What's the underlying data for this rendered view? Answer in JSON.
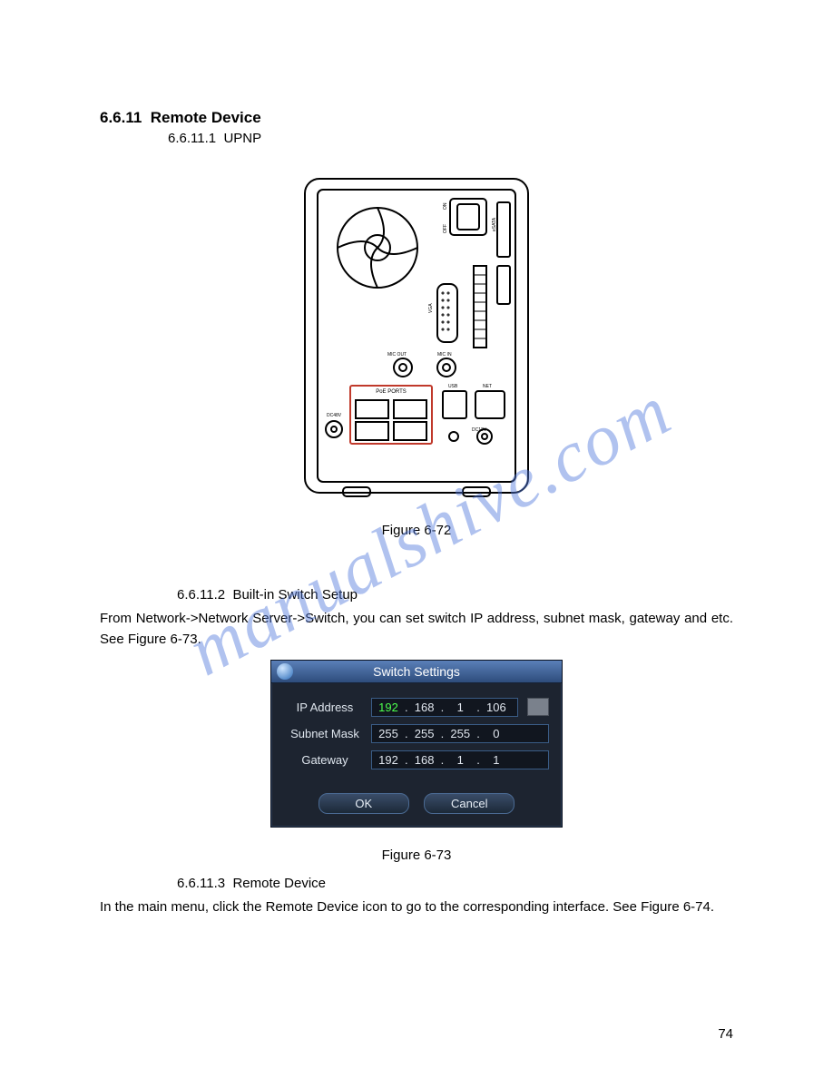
{
  "watermark": "manualshive.com",
  "section": {
    "number": "6.6.11",
    "title": "Remote Device",
    "sub1_number": "6.6.11.1",
    "sub1_title": "UPNP",
    "fig1_caption": "Figure 6-72",
    "sub2_number": "6.6.11.2",
    "sub2_title": "Built-in Switch Setup",
    "para1": "From Network->Network Server->Switch, you can set switch IP address, subnet mask, gateway and etc. See Figure 6-73.",
    "fig2_caption": "Figure 6-73",
    "sub3_number": "6.6.11.3",
    "sub3_title": "Remote Device",
    "para2": "In the main menu, click the Remote Device icon to go to the corresponding interface. See Figure 6-74."
  },
  "device_labels": {
    "poe": "PoE PORTS",
    "vga": "VGA",
    "mic_out": "MIC OUT",
    "mic_in": "MIC IN",
    "usb": "USB",
    "net": "NET",
    "dc48": "DC48V",
    "dc12": "DC12V",
    "esata": "eSATA",
    "on": "ON",
    "off": "OFF"
  },
  "switch_dialog": {
    "title": "Switch Settings",
    "rows": {
      "ip_label": "IP Address",
      "ip_value": [
        "192",
        "168",
        "1",
        "106"
      ],
      "mask_label": "Subnet Mask",
      "mask_value": [
        "255",
        "255",
        "255",
        "0"
      ],
      "gw_label": "Gateway",
      "gw_value": [
        "192",
        "168",
        "1",
        "1"
      ]
    },
    "ok": "OK",
    "cancel": "Cancel"
  },
  "page_number": "74"
}
